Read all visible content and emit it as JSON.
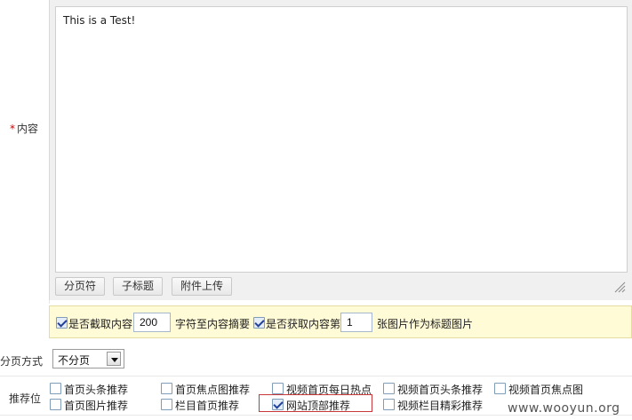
{
  "form": {
    "content_label_star": "*",
    "content_label": "内容",
    "editor_text": "This is a Test!",
    "editor_buttons": [
      "分页符",
      "子标题",
      "附件上传"
    ]
  },
  "options": {
    "auto_summary_checked": true,
    "auto_summary_label": "是否截取内容",
    "summary_length": "200",
    "summary_suffix": "字符至内容摘要",
    "auto_thumb_checked": true,
    "auto_thumb_label": "是否获取内容第",
    "thumb_index": "1",
    "thumb_suffix": "张图片作为标题图片"
  },
  "paging": {
    "label": "分页方式",
    "selected": "不分页"
  },
  "positions": {
    "label": "推荐位",
    "items": [
      {
        "label": "首页头条推荐",
        "checked": false
      },
      {
        "label": "首页焦点图推荐",
        "checked": false
      },
      {
        "label": "视频首页每日热点",
        "checked": false
      },
      {
        "label": "视频首页头条推荐",
        "checked": false
      },
      {
        "label": "视频首页焦点图",
        "checked": false
      },
      {
        "label": "首页图片推荐",
        "checked": false
      },
      {
        "label": "栏目首页推荐",
        "checked": false
      },
      {
        "label": "网站顶部推荐",
        "checked": true
      },
      {
        "label": "视频栏目精彩推荐",
        "checked": false
      }
    ]
  },
  "watermark": "www.wooyun.org",
  "colors": {
    "required_star": "#d40000",
    "options_bar_bg": "#fffbd6",
    "highlight_border": "#c8383a"
  }
}
